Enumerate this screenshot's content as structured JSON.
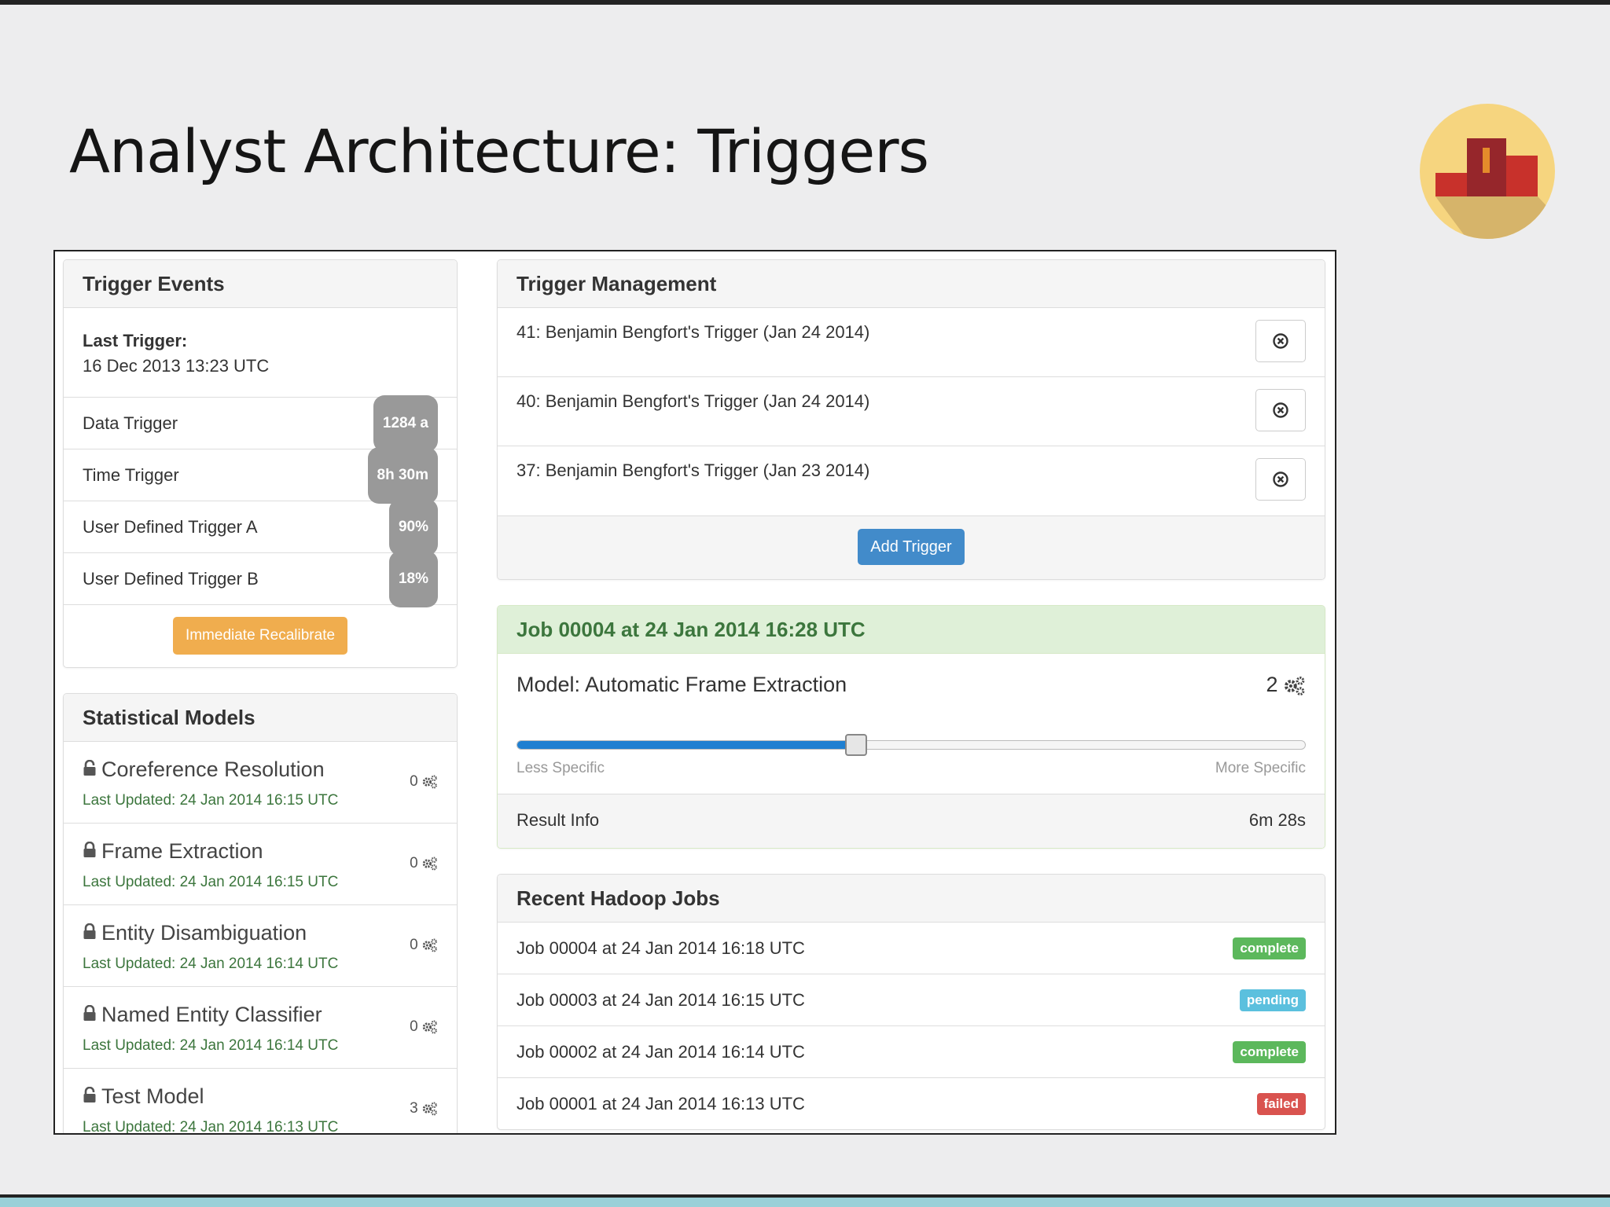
{
  "slide": {
    "title": "Analyst Architecture: Triggers"
  },
  "trigger_events": {
    "heading": "Trigger Events",
    "last_trigger_label": "Last Trigger:",
    "last_trigger_value": "16 Dec 2013 13:23 UTC",
    "items": [
      {
        "label": "Data Trigger",
        "badge": "1284 a"
      },
      {
        "label": "Time Trigger",
        "badge": "8h 30m"
      },
      {
        "label": "User Defined Trigger A",
        "badge": "90%"
      },
      {
        "label": "User Defined Trigger B",
        "badge": "18%"
      }
    ],
    "recalibrate_label": "Immediate Recalibrate",
    "recalibrate_color": "#f0ad4e"
  },
  "statistical_models": {
    "heading": "Statistical Models",
    "items": [
      {
        "name": "Coreference Resolution",
        "updated": "Last Updated: 24 Jan 2014 16:15 UTC",
        "count": "0",
        "lock": "unlocked"
      },
      {
        "name": "Frame Extraction",
        "updated": "Last Updated: 24 Jan 2014 16:15 UTC",
        "count": "0",
        "lock": "locked"
      },
      {
        "name": "Entity Disambiguation",
        "updated": "Last Updated: 24 Jan 2014 16:14 UTC",
        "count": "0",
        "lock": "locked"
      },
      {
        "name": "Named Entity Classifier",
        "updated": "Last Updated: 24 Jan 2014 16:14 UTC",
        "count": "0",
        "lock": "locked"
      },
      {
        "name": "Test Model",
        "updated": "Last Updated: 24 Jan 2014 16:13 UTC",
        "count": "3",
        "lock": "unlocked"
      }
    ]
  },
  "trigger_management": {
    "heading": "Trigger Management",
    "items": [
      {
        "label": "41: Benjamin Bengfort's Trigger (Jan 24 2014)"
      },
      {
        "label": "40: Benjamin Bengfort's Trigger (Jan 24 2014)"
      },
      {
        "label": "37: Benjamin Bengfort's Trigger (Jan 23 2014)"
      }
    ],
    "add_label": "Add Trigger",
    "add_color": "#428bca"
  },
  "job": {
    "heading": "Job 00004 at 24 Jan 2014 16:28 UTC",
    "model_label": "Model: Automatic Frame Extraction",
    "model_count": "2",
    "slider_fraction": 0.43,
    "slider_min_label": "Less Specific",
    "slider_max_label": "More Specific",
    "result_label": "Result Info",
    "result_value": "6m 28s",
    "success_color": "#3c763d"
  },
  "hadoop": {
    "heading": "Recent Hadoop Jobs",
    "items": [
      {
        "label": "Job 00004 at 24 Jan 2014 16:18 UTC",
        "status": "complete",
        "color": "#5cb85c"
      },
      {
        "label": "Job 00003 at 24 Jan 2014 16:15 UTC",
        "status": "pending",
        "color": "#5bc0de"
      },
      {
        "label": "Job 00002 at 24 Jan 2014 16:14 UTC",
        "status": "complete",
        "color": "#5cb85c"
      },
      {
        "label": "Job 00001 at 24 Jan 2014 16:13 UTC",
        "status": "failed",
        "color": "#d9534f"
      }
    ]
  },
  "icons": {
    "logo": "podium-logo-icon",
    "remove": "circle-x-icon",
    "gears": "gears-icon",
    "lock": "padlock-icon"
  }
}
